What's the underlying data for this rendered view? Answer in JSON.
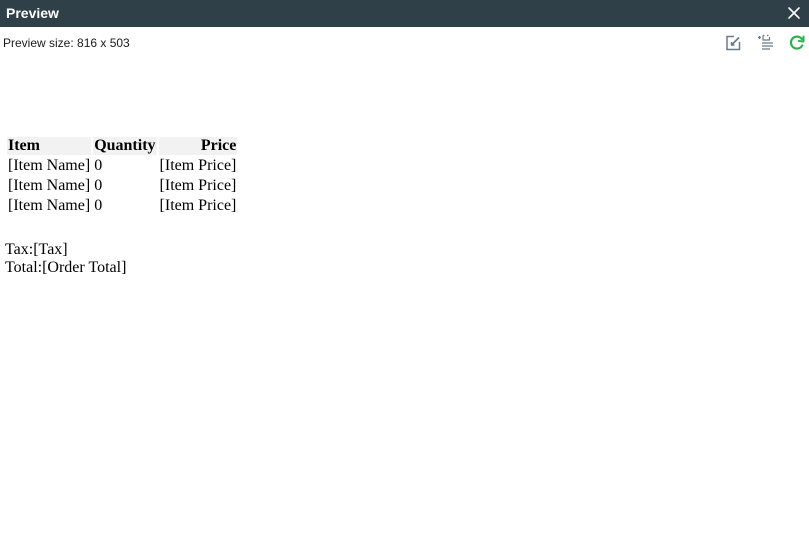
{
  "window": {
    "title": "Preview"
  },
  "toolbar": {
    "preview_size": "Preview size: 816 x 503",
    "icons": [
      "edit-icon",
      "list-add-icon",
      "refresh-icon"
    ],
    "colors": {
      "icon_gray": "#6b7b85",
      "refresh_green": "#2bb24c"
    }
  },
  "colors": {
    "titlebar": "#2f4049",
    "header_bg": "#f2f2f2"
  },
  "table": {
    "headers": {
      "item": "Item",
      "quantity": "Quantity",
      "price": "Price"
    },
    "rows": [
      {
        "item": "[Item Name]",
        "quantity": "0",
        "price": "[Item Price]"
      },
      {
        "item": "[Item Name]",
        "quantity": "0",
        "price": "[Item Price]"
      },
      {
        "item": "[Item Name]",
        "quantity": "0",
        "price": "[Item Price]"
      }
    ]
  },
  "totals": {
    "tax": "Tax:[Tax]",
    "total": "Total:[Order Total]"
  }
}
